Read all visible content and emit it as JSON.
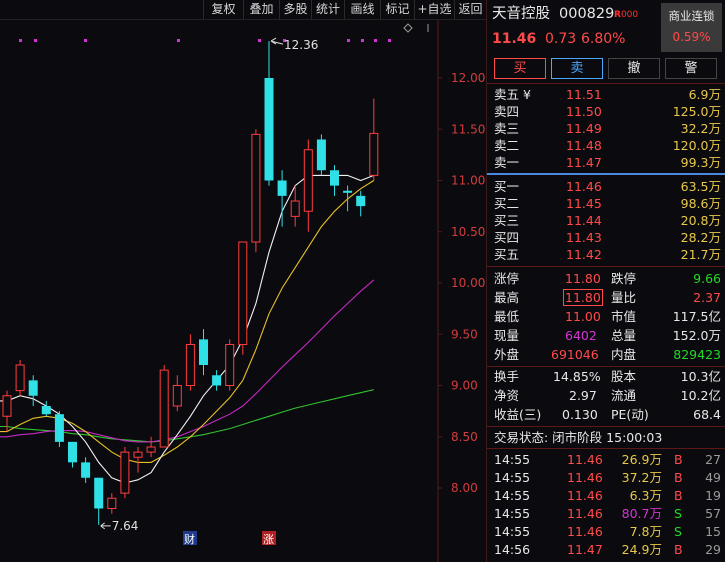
{
  "toolbar": {
    "items": [
      "复权",
      "叠加",
      "多股",
      "统计",
      "画线",
      "标记",
      "+自选",
      "返回"
    ]
  },
  "stock": {
    "name": "天音控股",
    "code": "000829",
    "badge": "R",
    "badge_suffix": "000",
    "price": "11.46",
    "change": "0.73",
    "change_pct": "6.80%",
    "sector_name": "商业连锁",
    "sector_pct": "0.59%"
  },
  "buttons": {
    "buy": "买",
    "sell": "卖",
    "cancel": "撤",
    "alert": "警"
  },
  "order_book": {
    "asks": [
      {
        "label": "卖五 ¥",
        "price": "11.51",
        "vol": "6.9万"
      },
      {
        "label": "卖四",
        "price": "11.50",
        "vol": "125.0万"
      },
      {
        "label": "卖三",
        "price": "11.49",
        "vol": "32.2万"
      },
      {
        "label": "卖二",
        "price": "11.48",
        "vol": "120.0万"
      },
      {
        "label": "卖一",
        "price": "11.47",
        "vol": "99.3万"
      }
    ],
    "bids": [
      {
        "label": "买一",
        "price": "11.46",
        "vol": "63.5万"
      },
      {
        "label": "买二",
        "price": "11.45",
        "vol": "98.6万"
      },
      {
        "label": "买三",
        "price": "11.44",
        "vol": "20.8万"
      },
      {
        "label": "买四",
        "price": "11.43",
        "vol": "28.2万"
      },
      {
        "label": "买五",
        "price": "11.42",
        "vol": "21.7万"
      }
    ]
  },
  "stats1": [
    {
      "l1": "涨停",
      "v1": "11.80",
      "l2": "跌停",
      "v2": "9.66"
    },
    {
      "l1": "最高",
      "v1": "11.80",
      "l2": "量比",
      "v2": "2.37"
    },
    {
      "l1": "最低",
      "v1": "11.00",
      "l2": "市值",
      "v2": "117.5亿"
    },
    {
      "l1": "现量",
      "v1": "6402",
      "l2": "总量",
      "v2": "152.0万"
    },
    {
      "l1": "外盘",
      "v1": "691046",
      "l2": "内盘",
      "v2": "829423"
    }
  ],
  "stats2": [
    {
      "l1": "换手",
      "v1": "14.85%",
      "l2": "股本",
      "v2": "10.3亿"
    },
    {
      "l1": "净资",
      "v1": "2.97",
      "l2": "流通",
      "v2": "10.2亿"
    },
    {
      "l1": "收益(三)",
      "v1": "0.130",
      "l2": "PE(动)",
      "v2": "68.4"
    }
  ],
  "trade_status": "交易状态: 闭市阶段 15:00:03",
  "ticks": [
    {
      "time": "14:55",
      "price": "11.46",
      "vol": "26.9万",
      "side": "B",
      "n": "27"
    },
    {
      "time": "14:55",
      "price": "11.46",
      "vol": "37.2万",
      "side": "B",
      "n": "49"
    },
    {
      "time": "14:55",
      "price": "11.46",
      "vol": "6.3万",
      "side": "B",
      "n": "19"
    },
    {
      "time": "14:55",
      "price": "11.46",
      "vol": "80.7万",
      "side": "S",
      "n": "57"
    },
    {
      "time": "14:55",
      "price": "11.46",
      "vol": "7.8万",
      "side": "S",
      "n": "15"
    },
    {
      "time": "14:56",
      "price": "11.47",
      "vol": "24.9万",
      "side": "B",
      "n": "29"
    }
  ],
  "chart_data": {
    "type": "candlestick",
    "y_ticks": [
      "12.00",
      "11.50",
      "11.00",
      "10.50",
      "10.00",
      "9.50",
      "9.00",
      "8.50",
      "8.00"
    ],
    "ylim": [
      7.3,
      12.6
    ],
    "high_label": "12.36",
    "low_label": "7.64",
    "markers": [
      "财",
      "涨"
    ],
    "candles": [
      {
        "o": 8.7,
        "h": 8.95,
        "l": 8.55,
        "c": 8.9
      },
      {
        "o": 8.95,
        "h": 9.25,
        "l": 8.9,
        "c": 9.2
      },
      {
        "o": 9.05,
        "h": 9.1,
        "l": 8.8,
        "c": 8.9
      },
      {
        "o": 8.8,
        "h": 8.85,
        "l": 8.7,
        "c": 8.72
      },
      {
        "o": 8.72,
        "h": 8.75,
        "l": 8.4,
        "c": 8.45
      },
      {
        "o": 8.45,
        "h": 8.45,
        "l": 8.2,
        "c": 8.25
      },
      {
        "o": 8.25,
        "h": 8.3,
        "l": 8.05,
        "c": 8.1
      },
      {
        "o": 8.1,
        "h": 8.1,
        "l": 7.64,
        "c": 7.8
      },
      {
        "o": 7.8,
        "h": 7.95,
        "l": 7.75,
        "c": 7.9
      },
      {
        "o": 7.95,
        "h": 8.4,
        "l": 7.9,
        "c": 8.35
      },
      {
        "o": 8.3,
        "h": 8.4,
        "l": 8.15,
        "c": 8.35
      },
      {
        "o": 8.35,
        "h": 8.5,
        "l": 8.3,
        "c": 8.4
      },
      {
        "o": 8.4,
        "h": 9.2,
        "l": 8.4,
        "c": 9.15
      },
      {
        "o": 8.8,
        "h": 9.1,
        "l": 8.75,
        "c": 9.0
      },
      {
        "o": 9.0,
        "h": 9.5,
        "l": 8.95,
        "c": 9.4
      },
      {
        "o": 9.45,
        "h": 9.55,
        "l": 9.1,
        "c": 9.2
      },
      {
        "o": 9.1,
        "h": 9.15,
        "l": 8.95,
        "c": 9.0
      },
      {
        "o": 9.0,
        "h": 9.45,
        "l": 8.95,
        "c": 9.4
      },
      {
        "o": 9.4,
        "h": 10.4,
        "l": 9.3,
        "c": 10.4
      },
      {
        "o": 10.4,
        "h": 11.5,
        "l": 10.3,
        "c": 11.45
      },
      {
        "o": 12.0,
        "h": 12.36,
        "l": 10.95,
        "c": 11.0
      },
      {
        "o": 11.0,
        "h": 11.1,
        "l": 10.55,
        "c": 10.85
      },
      {
        "o": 10.65,
        "h": 10.95,
        "l": 10.55,
        "c": 10.8
      },
      {
        "o": 10.7,
        "h": 11.4,
        "l": 10.5,
        "c": 11.3
      },
      {
        "o": 11.4,
        "h": 11.45,
        "l": 11.05,
        "c": 11.1
      },
      {
        "o": 11.1,
        "h": 11.15,
        "l": 10.85,
        "c": 10.95
      },
      {
        "o": 10.9,
        "h": 10.95,
        "l": 10.7,
        "c": 10.88
      },
      {
        "o": 10.85,
        "h": 10.9,
        "l": 10.65,
        "c": 10.75
      },
      {
        "o": 11.05,
        "h": 11.8,
        "l": 11.0,
        "c": 11.46
      }
    ],
    "ma_white": [
      8.85,
      8.9,
      8.87,
      8.8,
      8.72,
      8.6,
      8.45,
      8.25,
      8.1,
      8.05,
      8.08,
      8.15,
      8.35,
      8.52,
      8.7,
      8.9,
      9.05,
      9.2,
      9.45,
      9.8,
      10.3,
      10.7,
      10.95,
      11.05,
      11.05,
      11.05,
      11.05,
      11.0,
      11.05
    ],
    "ma_yellow": [
      8.55,
      8.62,
      8.68,
      8.7,
      8.68,
      8.63,
      8.55,
      8.45,
      8.35,
      8.28,
      8.25,
      8.25,
      8.32,
      8.4,
      8.5,
      8.62,
      8.75,
      8.88,
      9.05,
      9.35,
      9.7,
      9.95,
      10.15,
      10.35,
      10.55,
      10.7,
      10.82,
      10.92,
      11.0
    ],
    "ma_magenta": [
      8.5,
      8.52,
      8.53,
      8.55,
      8.56,
      8.56,
      8.55,
      8.52,
      8.49,
      8.46,
      8.45,
      8.45,
      8.47,
      8.5,
      8.55,
      8.6,
      8.66,
      8.72,
      8.8,
      8.92,
      9.05,
      9.18,
      9.3,
      9.42,
      9.55,
      9.68,
      9.8,
      9.92,
      10.03
    ],
    "ma_green": [
      8.6,
      8.58,
      8.57,
      8.56,
      8.55,
      8.53,
      8.52,
      8.5,
      8.48,
      8.47,
      8.46,
      8.45,
      8.46,
      8.48,
      8.5,
      8.52,
      8.55,
      8.58,
      8.62,
      8.66,
      8.7,
      8.74,
      8.78,
      8.81,
      8.84,
      8.87,
      8.9,
      8.93,
      8.96
    ]
  }
}
